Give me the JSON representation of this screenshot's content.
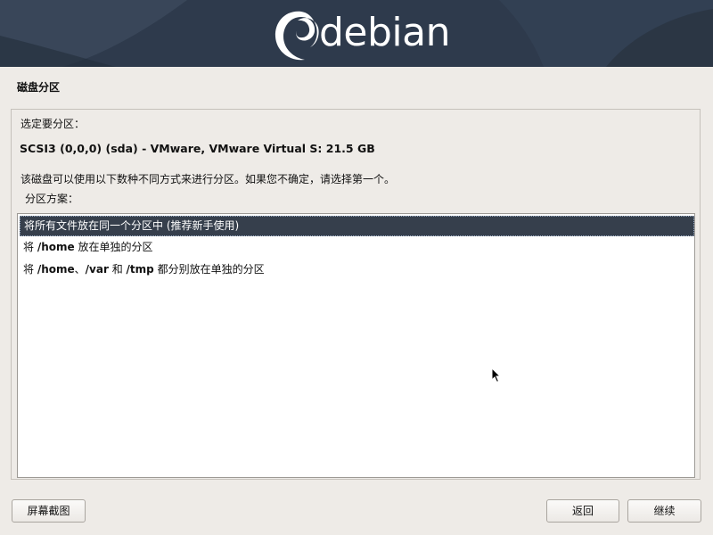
{
  "header": {
    "logo_text": "debian",
    "colors": {
      "banner": "#2e3a4c",
      "logo": "#ffffff"
    }
  },
  "page": {
    "title": "磁盘分区",
    "prompt": "选定要分区：",
    "disk": "SCSI3 (0,0,0) (sda) - VMware, VMware Virtual S: 21.5 GB",
    "description": "该磁盘可以使用以下数种不同方式来进行分区。如果您不确定，请选择第一个。",
    "scheme_label": "分区方案："
  },
  "options": [
    {
      "parts": [
        "将所有文件放在同一个分区中 (推荐新手使用)"
      ],
      "selected": true
    },
    {
      "parts": [
        "将 ",
        "/home",
        " 放在单独的分区"
      ],
      "selected": false
    },
    {
      "parts": [
        "将 ",
        "/home",
        "、",
        "/var",
        " 和 ",
        "/tmp",
        " 都分别放在单独的分区"
      ],
      "selected": false
    }
  ],
  "buttons": {
    "screenshot": "屏幕截图",
    "back": "返回",
    "continue": "继续"
  },
  "colors": {
    "selection": "#363f4c",
    "background": "#eeebe7"
  }
}
